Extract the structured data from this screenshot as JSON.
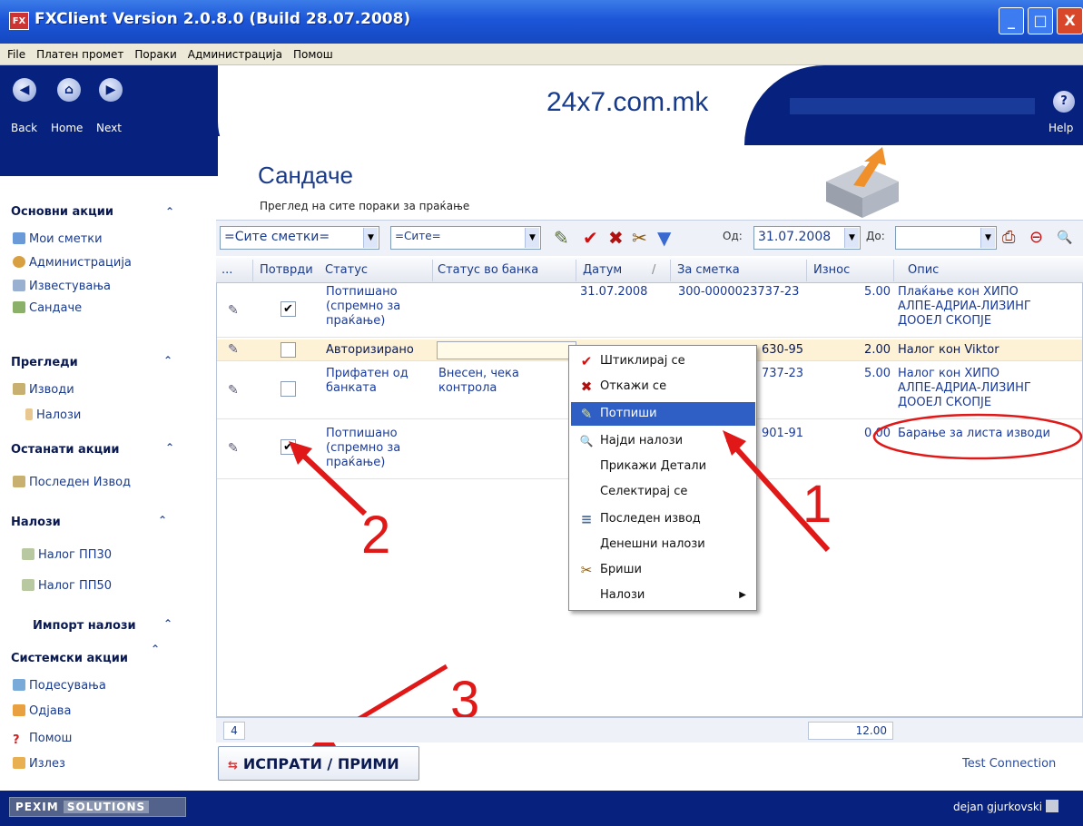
{
  "window": {
    "title": "FXClient Version 2.0.8.0 (Build 28.07.2008)",
    "icon_label": "FX",
    "buttons": [
      "_",
      "□",
      "X"
    ]
  },
  "menu": [
    "File",
    "Платен промет",
    "Пораки",
    "Администрација",
    "Помош"
  ],
  "header": {
    "site": "24x7.com.mk",
    "nav": [
      {
        "icon": "back-arrow-icon",
        "glyph": "◀",
        "label": "Back"
      },
      {
        "icon": "home-icon",
        "glyph": "⌂",
        "label": "Home"
      },
      {
        "icon": "next-arrow-icon",
        "glyph": "▶",
        "label": "Next"
      }
    ],
    "help": {
      "glyph": "?",
      "label": "Help"
    }
  },
  "sidebar": {
    "sections": [
      {
        "title": "Основни акции",
        "items": [
          {
            "icon": "accounts-icon",
            "label": "Мои сметки"
          },
          {
            "icon": "admin-icon",
            "label": "Администрација"
          },
          {
            "icon": "reports-icon",
            "label": "Известувања"
          },
          {
            "icon": "mailbox-icon",
            "label": "Сандаче"
          }
        ]
      },
      {
        "title": "Прегледи",
        "items": [
          {
            "icon": "statements-icon",
            "label": "Изводи"
          },
          {
            "icon": "orders-icon",
            "label": "Налози"
          }
        ]
      },
      {
        "title": "Останати акции",
        "items": [
          {
            "icon": "statement-icon",
            "label": "Последен Извод"
          }
        ]
      },
      {
        "title": "Налози",
        "items": [
          {
            "icon": "order-pp30-icon",
            "label": "Налог ПП30"
          },
          {
            "icon": "order-pp50-icon",
            "label": "Налог ПП50"
          }
        ]
      },
      {
        "title": "Импорт налози",
        "items": []
      },
      {
        "title": "Системски акции",
        "items": [
          {
            "icon": "settings-icon",
            "label": "Подесувања"
          },
          {
            "icon": "logout-icon",
            "label": "Одјава"
          },
          {
            "icon": "help-icon",
            "label": "Помош"
          },
          {
            "icon": "exit-icon",
            "label": "Излез"
          }
        ]
      }
    ],
    "collapse_glyph": "⌃"
  },
  "page": {
    "title": "Сандаче",
    "subtitle": "Преглед на сите пораки за праќање"
  },
  "toolbar": {
    "accounts_filter": "=Сите сметки=",
    "status_filter": "=Сите=",
    "from_label": "Од:",
    "from_date": "31.07.2008",
    "to_label": "До:",
    "to_date": "",
    "icons": [
      "sign-icon",
      "check-icon",
      "cancel-icon",
      "delete-icon",
      "filter-icon",
      "print-icon",
      "refresh-icon",
      "search-icon"
    ]
  },
  "grid": {
    "columns": [
      "...",
      "Потврди",
      "Статус",
      "Статус во банка",
      "Датум",
      "/",
      "За сметка",
      "Износ",
      "Опис"
    ],
    "rows": [
      {
        "checked": true,
        "status": "Потпишано\n(спремно за\nпраќање)",
        "bank_status": "",
        "date": "31.07.2008",
        "account": "300-0000023737-23",
        "amount": "5.00",
        "description": "Плаќање кон ХИПО\nАЛПЕ-АДРИА-ЛИЗИНГ\nДООЕЛ СКОПЈЕ"
      },
      {
        "checked": false,
        "status": "Авторизирано",
        "bank_status": "",
        "date": "",
        "account": "630-95",
        "amount": "2.00",
        "description": "Налог кон Viktor"
      },
      {
        "checked": false,
        "status": "Прифатен од\nбанката",
        "bank_status": "Внесен, чека\nконтрола",
        "date": "",
        "account": "737-23",
        "amount": "5.00",
        "description": "Налог кон ХИПО\nАЛПЕ-АДРИА-ЛИЗИНГ\nДООЕЛ СКОПЈЕ"
      },
      {
        "checked": true,
        "status": "Потпишано\n(спремно за\nпраќање)",
        "bank_status": "",
        "date": "",
        "account": "901-91",
        "amount": "0.00",
        "description": "Барање за листа изводи"
      }
    ],
    "row_count": "4",
    "total": "12.00"
  },
  "context_menu": [
    {
      "icon": "check-icon",
      "glyph": "✔",
      "color": "#d01010",
      "label": "Штиклирај се"
    },
    {
      "icon": "cancel-icon",
      "glyph": "✖",
      "color": "#b01010",
      "label": "Откажи се"
    },
    {
      "icon": "sign-pen-icon",
      "glyph": "✎",
      "color": "#556b2f",
      "label": "Потпиши"
    },
    {
      "icon": "search-icon",
      "glyph": "🔍",
      "color": "#666666",
      "label": "Најди налози"
    },
    {
      "icon": "",
      "glyph": "",
      "color": "",
      "label": "Прикажи Детали"
    },
    {
      "icon": "",
      "glyph": "",
      "color": "",
      "label": "Селектирај се"
    },
    {
      "icon": "statement-icon",
      "glyph": "≡",
      "color": "#4a6a9a",
      "label": "Последен извод"
    },
    {
      "icon": "",
      "glyph": "",
      "color": "",
      "label": "Денешни налози"
    },
    {
      "icon": "delete-icon",
      "glyph": "✂",
      "color": "#8a5a10",
      "label": "Бриши"
    },
    {
      "icon": "",
      "glyph": "",
      "color": "",
      "label": "Налози"
    }
  ],
  "context_menu_selected": "Потпиши",
  "annotations": [
    "1",
    "2",
    "3"
  ],
  "footer": {
    "send_button": "ИСПРАТИ / ПРИМИ",
    "test_connection": "Test Connection",
    "brand_left": "PEXIM",
    "brand_right": "SOLUTIONS",
    "user": "dejan gjurkovski"
  },
  "colors": {
    "titlebar": "#1c56d8",
    "navy": "#07227e",
    "accent_red": "#e01818",
    "selection": "#2f5fc4"
  }
}
